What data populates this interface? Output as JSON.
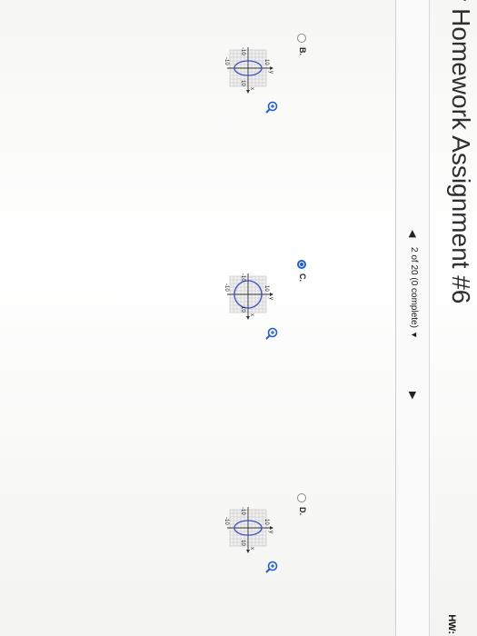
{
  "header": {
    "title": "r Homework Assignment #6",
    "hw_tag": "HW:"
  },
  "nav": {
    "prev_icon": "triangle-left-icon",
    "progress_text": "2 of 20 (0 complete)",
    "dropdown_caret": "▼",
    "next_icon": "triangle-right-icon"
  },
  "options": [
    {
      "label": "B.",
      "selected": false,
      "ellipse": "vertical-narrow"
    },
    {
      "label": "C.",
      "selected": true,
      "ellipse": "circle"
    },
    {
      "label": "D.",
      "selected": false,
      "ellipse": "vertical-narrow"
    }
  ],
  "graph": {
    "y_axis_label": "y",
    "x_axis_label": "x",
    "tick_top": "10",
    "tick_left": "-10",
    "tick_right": "10",
    "tick_bottom": "-10"
  },
  "colors": {
    "curve": "#3a52c4",
    "accent": "#1e5ecf",
    "grid": "#bdbdbd"
  }
}
